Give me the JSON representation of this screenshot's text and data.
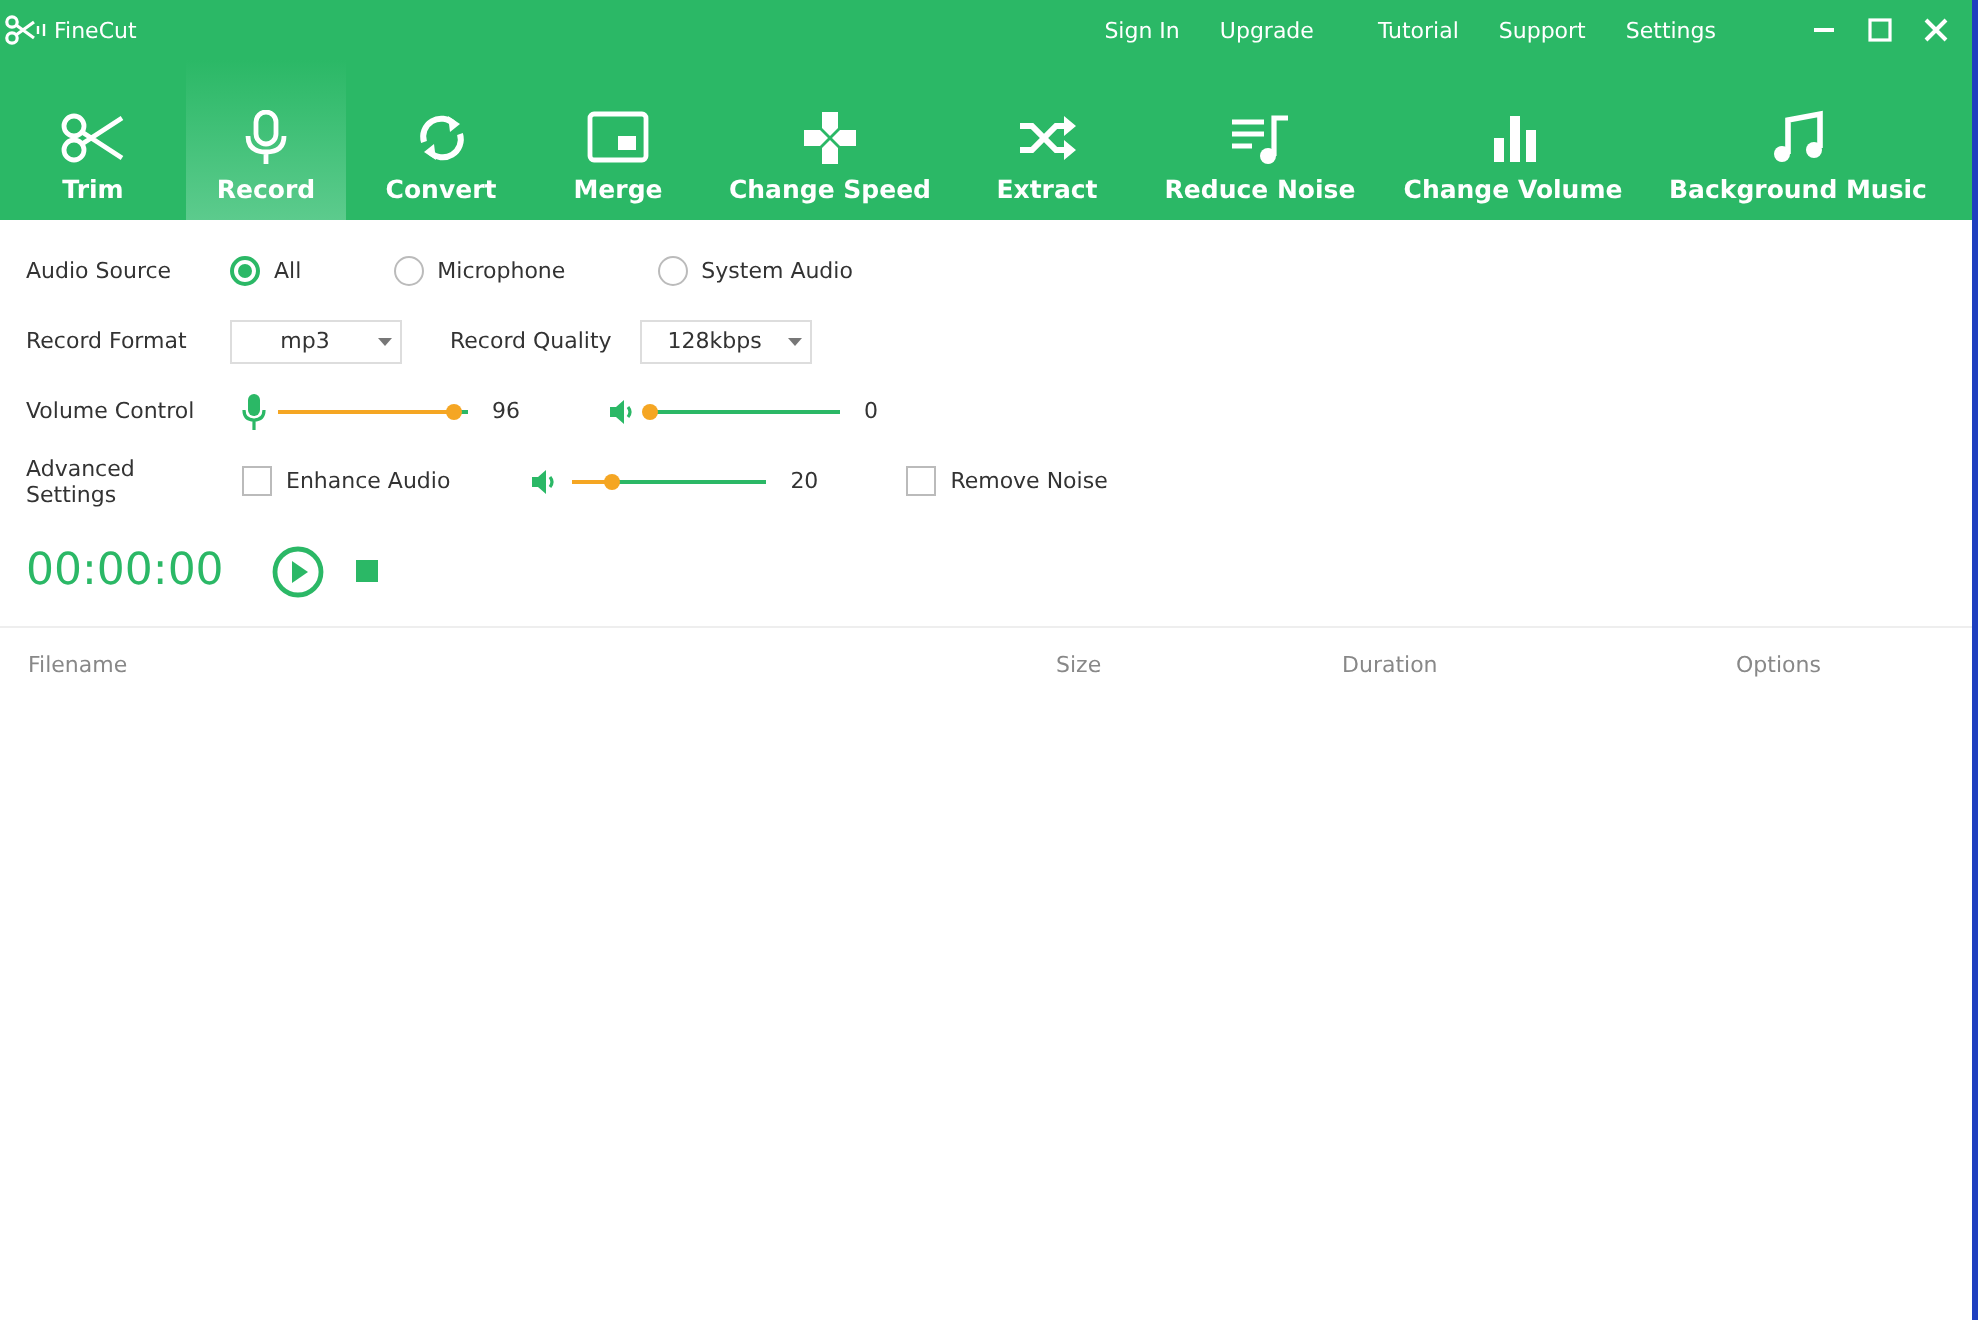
{
  "window": {
    "title": "FineCut"
  },
  "top_links": [
    "Sign In",
    "Upgrade",
    "Tutorial",
    "Support",
    "Settings"
  ],
  "tabs": [
    {
      "label": "Trim",
      "selected": false
    },
    {
      "label": "Record",
      "selected": true
    },
    {
      "label": "Convert",
      "selected": false
    },
    {
      "label": "Merge",
      "selected": false
    },
    {
      "label": "Change Speed",
      "selected": false
    },
    {
      "label": "Extract",
      "selected": false
    },
    {
      "label": "Reduce Noise",
      "selected": false
    },
    {
      "label": "Change Volume",
      "selected": false
    },
    {
      "label": "Background Music",
      "selected": false
    }
  ],
  "audio_source": {
    "label": "Audio Source",
    "options": [
      {
        "label": "All",
        "selected": true
      },
      {
        "label": "Microphone",
        "selected": false
      },
      {
        "label": "System Audio",
        "selected": false
      }
    ]
  },
  "record_format": {
    "label": "Record Format",
    "value": "mp3"
  },
  "record_quality": {
    "label": "Record Quality",
    "value": "128kbps"
  },
  "volume_control": {
    "label": "Volume Control",
    "microphone": {
      "level": 0.93,
      "reading": "96"
    },
    "speaker": {
      "level": 0.0,
      "reading": "0"
    }
  },
  "advanced_settings": {
    "label": "Advanced Settings",
    "enhance_audio": {
      "label": "Enhance Audio",
      "checked": false
    },
    "enhance_level": {
      "level": 0.2,
      "reading": "20"
    },
    "remove_noise": {
      "label": "Remove Noise",
      "checked": false
    }
  },
  "timer": "00:00:00",
  "table": {
    "columns": [
      "Filename",
      "Size",
      "Duration",
      "Options"
    ]
  }
}
